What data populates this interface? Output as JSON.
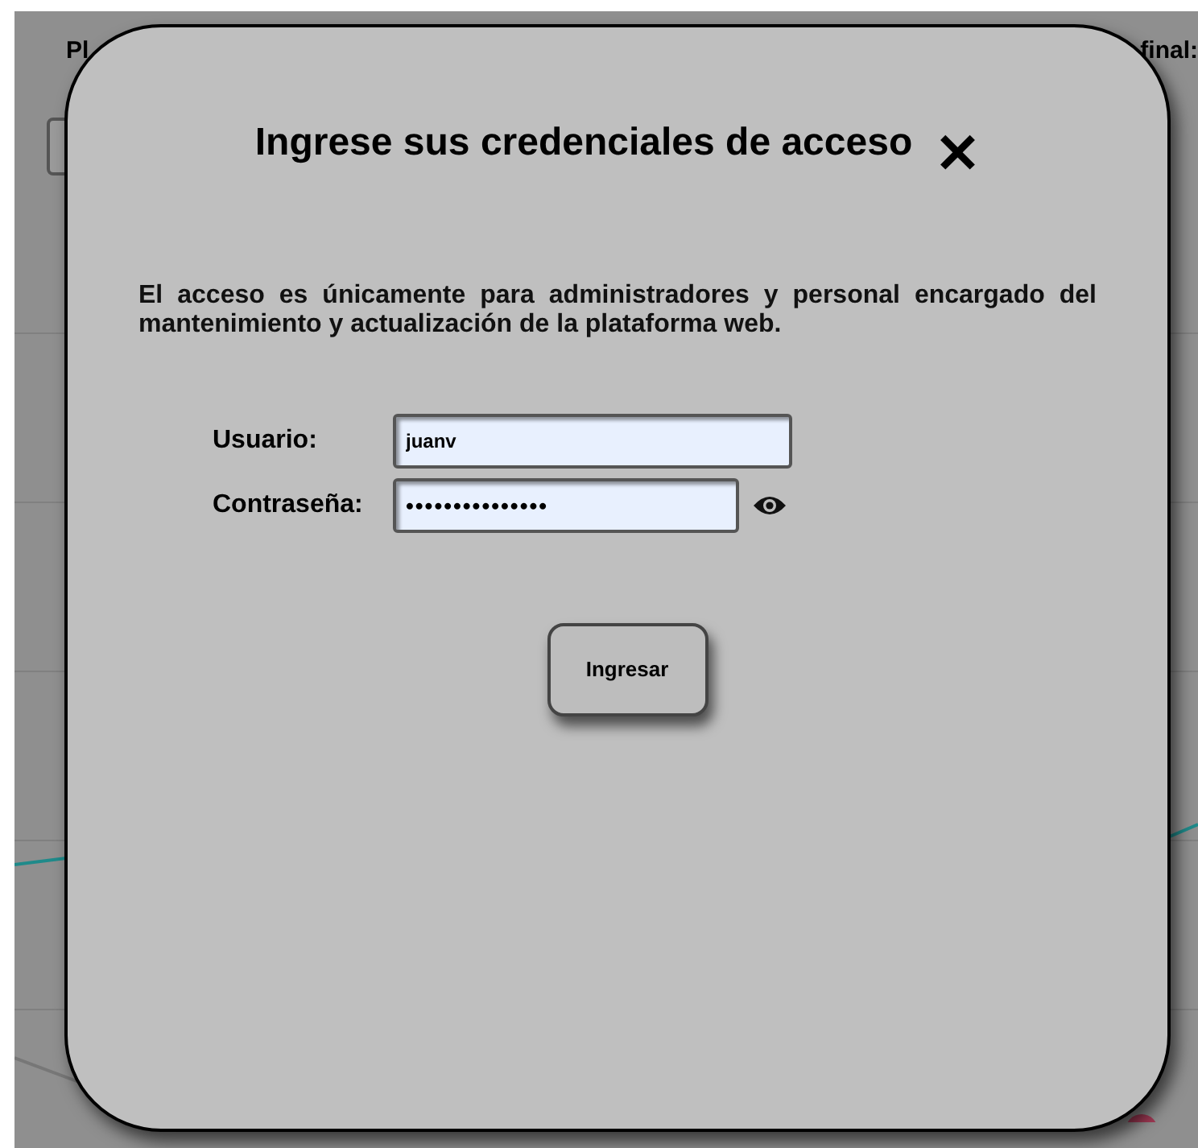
{
  "background": {
    "left_label": "Pl",
    "right_label": "final:"
  },
  "dialog": {
    "title": "Ingrese sus credenciales de acceso",
    "close": "✕",
    "message": "El acceso es únicamente para administradores y personal encargado del mantenimiento y actualización de la plataforma web.",
    "fields": [
      {
        "label": "Usuario:",
        "kind": "text",
        "value": "juanv"
      },
      {
        "label": "Contraseña:",
        "kind": "password",
        "value": "•••••••••••••••"
      }
    ],
    "submit": "Ingresar"
  }
}
